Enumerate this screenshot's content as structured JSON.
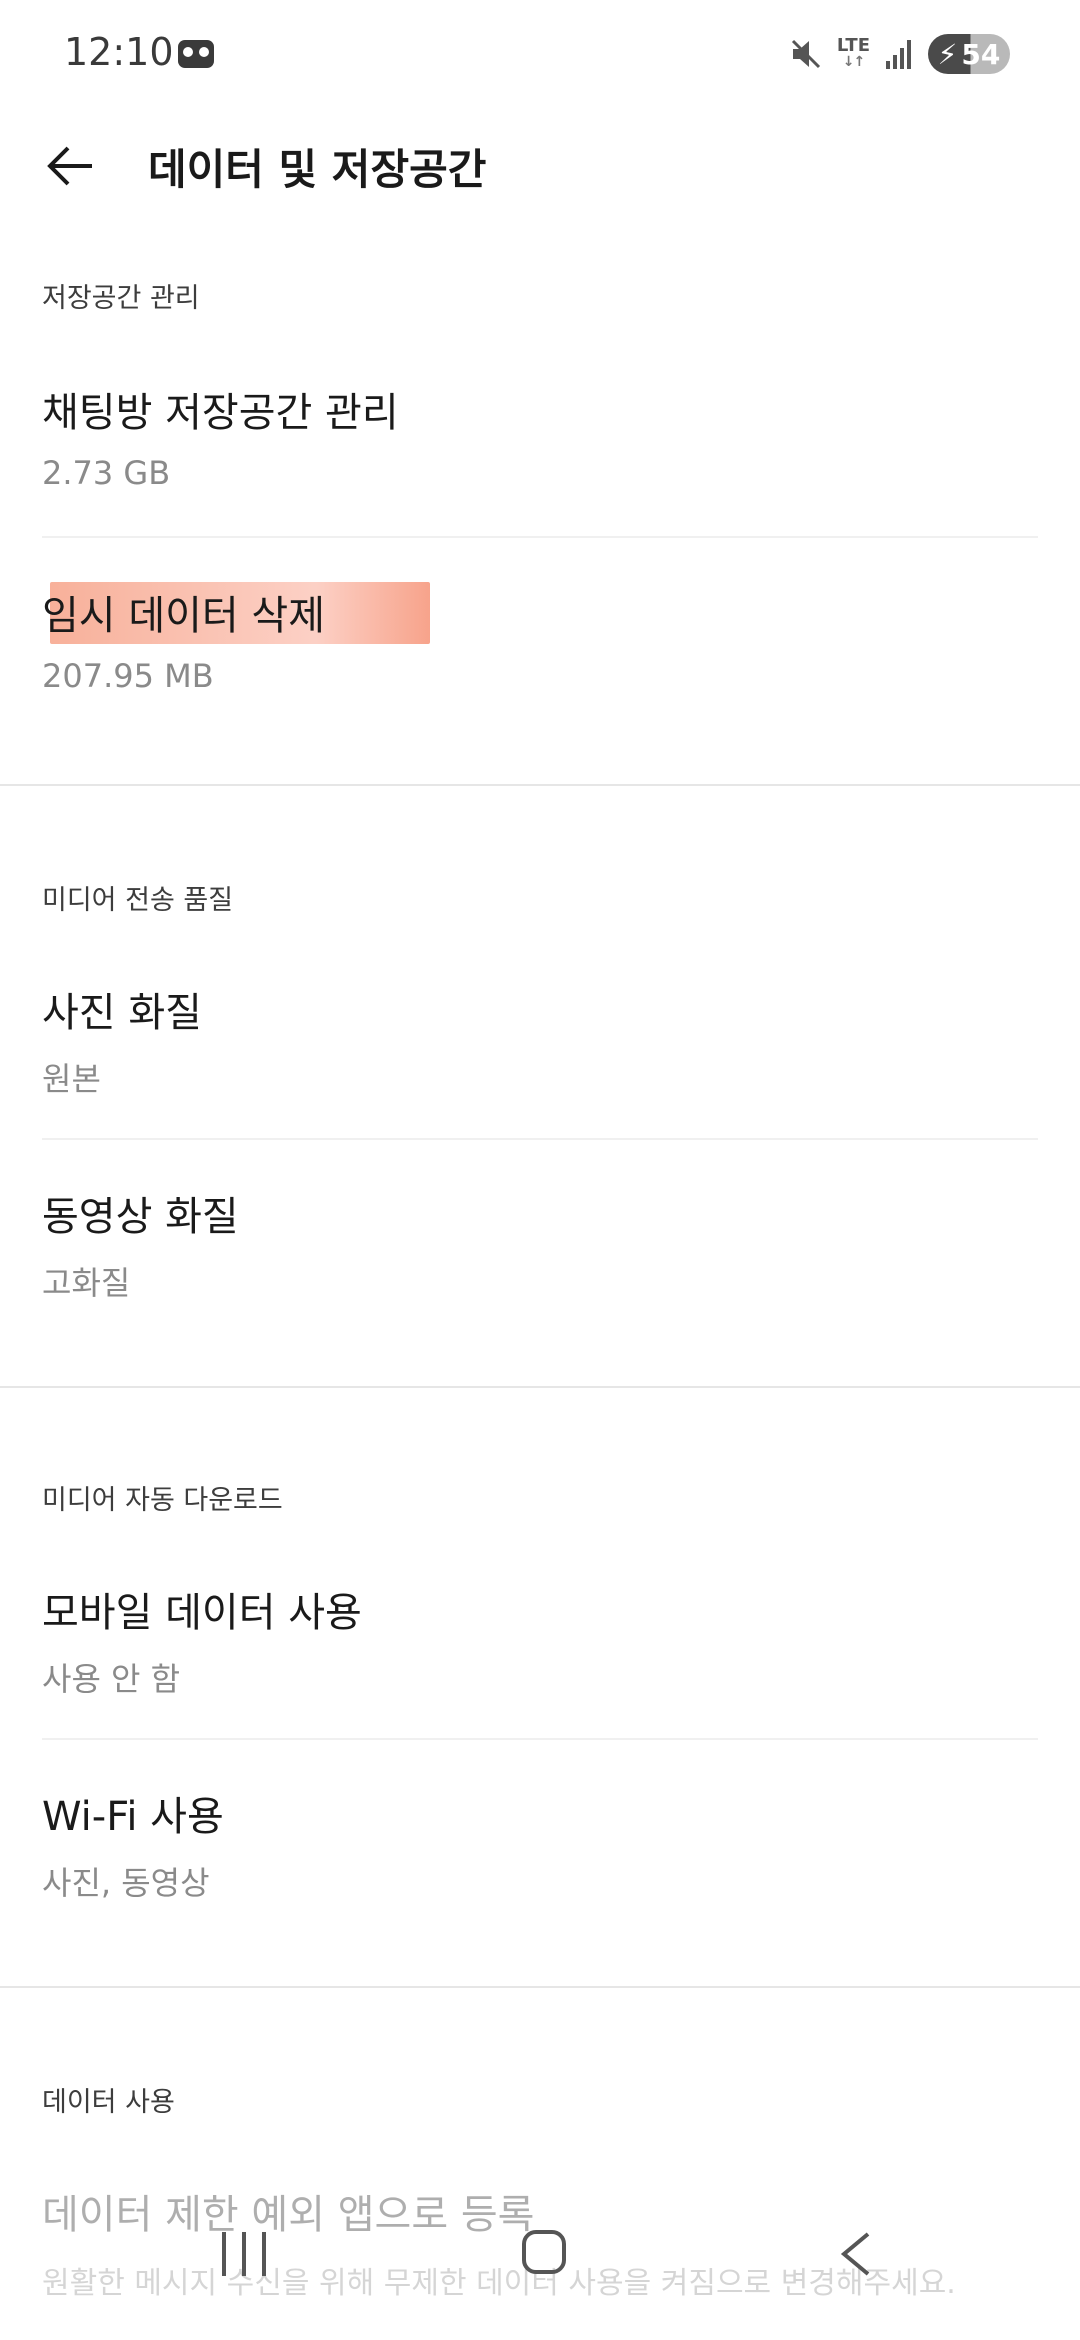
{
  "status_bar": {
    "time": "12:10",
    "network": "LTE",
    "battery": "54",
    "icons": [
      "voicemail-icon",
      "mute-icon",
      "lte-icon",
      "signal-icon",
      "battery-charging-icon"
    ]
  },
  "header": {
    "title": "데이터 및 저장공간",
    "back_icon": "arrow-left-icon"
  },
  "sections": {
    "storage": {
      "header": "저장공간 관리",
      "items": [
        {
          "title": "채팅방 저장공간 관리",
          "value": "2.73 GB"
        },
        {
          "title": "임시 데이터 삭제",
          "value": "207.95 MB"
        }
      ]
    },
    "media_quality": {
      "header": "미디어 전송 품질",
      "items": [
        {
          "title": "사진 화질",
          "value": "원본"
        },
        {
          "title": "동영상 화질",
          "value": "고화질"
        }
      ]
    },
    "auto_download": {
      "header": "미디어 자동 다운로드",
      "items": [
        {
          "title": "모바일 데이터 사용",
          "value": "사용 안 함"
        },
        {
          "title": "Wi-Fi 사용",
          "value": "사진, 동영상"
        }
      ]
    },
    "data_usage": {
      "header": "데이터 사용",
      "items": [
        {
          "title": "데이터 제한 예외 앱으로 등록",
          "value": "원활한 메시지 수신을 위해 무제한 데이터 사용을 켜짐으로 변경해주세요."
        }
      ]
    }
  },
  "colors": {
    "highlight": "#f59678",
    "divider": "#e6e6e6",
    "secondary_text": "#8a8a8a"
  },
  "nav_bar": {
    "icons": [
      "recents-icon",
      "home-icon",
      "back-icon"
    ]
  }
}
